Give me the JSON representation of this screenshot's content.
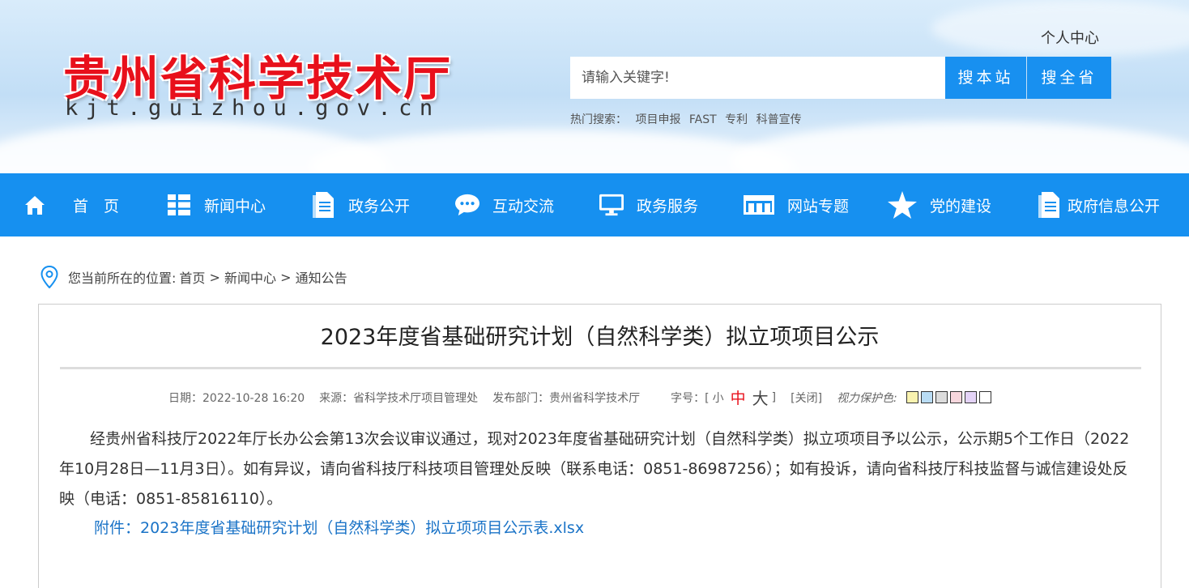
{
  "header": {
    "site_title": "贵州省科学技术厅",
    "site_url": "kjt.guizhou.gov.cn",
    "personal_center": "个人中心",
    "search_placeholder": "请输入关键字!",
    "search_site_label": "搜本站",
    "search_province_label": "搜全省",
    "hot_label": "热门搜索：",
    "hot_items": [
      "项目申报",
      "FAST",
      "专利",
      "科普宣传"
    ]
  },
  "nav": {
    "items": [
      {
        "label": "首　页",
        "icon": "home-icon"
      },
      {
        "label": "新闻中心",
        "icon": "list-icon"
      },
      {
        "label": "政务公开",
        "icon": "document-icon"
      },
      {
        "label": "互动交流",
        "icon": "chat-icon"
      },
      {
        "label": "政务服务",
        "icon": "monitor-icon"
      },
      {
        "label": "网站专题",
        "icon": "folder-icon"
      },
      {
        "label": "党的建设",
        "icon": "star-icon"
      },
      {
        "label": "政府信息公开",
        "icon": "document-icon"
      }
    ]
  },
  "breadcrumb": {
    "prefix": "您当前所在的位置:",
    "items": [
      "首页",
      "新闻中心",
      "通知公告"
    ],
    "separator": " > "
  },
  "article": {
    "title": "2023年度省基础研究计划（自然科学类）拟立项项目公示",
    "date": "日期：2022-10-28 16:20",
    "source": "来源：省科学技术厅项目管理处",
    "publisher": "发布部门：贵州省科学技术厅",
    "font_size_label": "字号：[",
    "font_small": "小",
    "font_mid": "中",
    "font_big": "大",
    "font_close_bracket": "]",
    "close_label": "[关闭]",
    "eye_protect_label": "视力保护色:",
    "swatch_colors": [
      "#faf3b0",
      "#b9dcf4",
      "#dcdcdc",
      "#f7d7dd",
      "#e4d3f7",
      "#ffffff"
    ],
    "body": "经贵州省科技厅2022年厅长办公会第13次会议审议通过，现对2023年度省基础研究计划（自然科学类）拟立项项目予以公示，公示期5个工作日（2022年10月28日—11月3日）。如有异议，请向省科技厅科技项目管理处反映（联系电话：0851-86987256）；如有投诉，请向省科技厅科技监督与诚信建设处反映（电话：0851-85816110）。",
    "attachment": "附件：2023年度省基础研究计划（自然科学类）拟立项项目公示表.xlsx"
  },
  "colors": {
    "nav_bg": "#1690f0",
    "search_btn": "#1890f0",
    "title_red": "#e8101b",
    "link_blue": "#1a73c7"
  }
}
